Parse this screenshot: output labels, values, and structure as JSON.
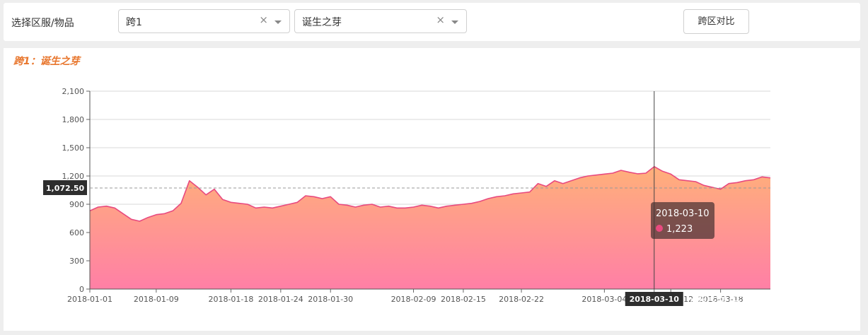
{
  "toolbar": {
    "label": "选择区服/物品",
    "server_select": {
      "value": "跨1",
      "clear": "×"
    },
    "item_select": {
      "value": "诞生之芽",
      "clear": "×"
    },
    "compare_button": "跨区对比"
  },
  "chart_data": {
    "type": "area",
    "title": "跨1：诞生之芽",
    "ylim": [
      0,
      2100
    ],
    "yticks": [
      0,
      300,
      600,
      900,
      1200,
      1500,
      1800,
      2100
    ],
    "ytick_labels": [
      "0",
      "300",
      "600",
      "900",
      "1,200",
      "1,500",
      "1,800",
      "2,100"
    ],
    "xtick_labels": [
      "2018-01-01",
      "2018-01-09",
      "2018-01-18",
      "2018-01-24",
      "2018-01-30",
      "2018-02-09",
      "2018-02-15",
      "2018-02-22",
      "2018-03-04",
      "2018-03-10",
      "2018-03-12",
      "2018-03-18"
    ],
    "x_start": "2018-01-01",
    "x_end": "2018-03-24",
    "grid": true,
    "average_line": {
      "value": 1072.5,
      "label": "1,072.50"
    },
    "crosshair": {
      "x": "2018-03-10",
      "label": "2018-03-10"
    },
    "tooltip": {
      "date": "2018-03-10",
      "value": 1223,
      "value_label": "1,223"
    },
    "colors": {
      "line": "#e84a7f",
      "fill_top": "#ffb07a",
      "fill_bottom": "#ff7fa6",
      "title": "#e8762d"
    },
    "x": [
      "2018-01-01",
      "2018-01-02",
      "2018-01-03",
      "2018-01-04",
      "2018-01-05",
      "2018-01-06",
      "2018-01-07",
      "2018-01-08",
      "2018-01-09",
      "2018-01-10",
      "2018-01-11",
      "2018-01-12",
      "2018-01-13",
      "2018-01-14",
      "2018-01-15",
      "2018-01-16",
      "2018-01-17",
      "2018-01-18",
      "2018-01-19",
      "2018-01-20",
      "2018-01-21",
      "2018-01-22",
      "2018-01-23",
      "2018-01-24",
      "2018-01-25",
      "2018-01-26",
      "2018-01-27",
      "2018-01-28",
      "2018-01-29",
      "2018-01-30",
      "2018-01-31",
      "2018-02-01",
      "2018-02-02",
      "2018-02-03",
      "2018-02-04",
      "2018-02-05",
      "2018-02-06",
      "2018-02-07",
      "2018-02-08",
      "2018-02-09",
      "2018-02-10",
      "2018-02-11",
      "2018-02-12",
      "2018-02-13",
      "2018-02-14",
      "2018-02-15",
      "2018-02-16",
      "2018-02-17",
      "2018-02-18",
      "2018-02-19",
      "2018-02-20",
      "2018-02-21",
      "2018-02-22",
      "2018-02-23",
      "2018-02-24",
      "2018-02-25",
      "2018-02-26",
      "2018-02-27",
      "2018-02-28",
      "2018-03-01",
      "2018-03-02",
      "2018-03-03",
      "2018-03-04",
      "2018-03-05",
      "2018-03-06",
      "2018-03-07",
      "2018-03-08",
      "2018-03-09",
      "2018-03-10",
      "2018-03-11",
      "2018-03-12",
      "2018-03-13",
      "2018-03-14",
      "2018-03-15",
      "2018-03-16",
      "2018-03-17",
      "2018-03-18",
      "2018-03-19",
      "2018-03-20",
      "2018-03-21",
      "2018-03-22",
      "2018-03-23",
      "2018-03-24"
    ],
    "values": [
      830,
      870,
      880,
      860,
      800,
      740,
      720,
      760,
      790,
      800,
      830,
      910,
      1150,
      1080,
      1000,
      1060,
      950,
      920,
      910,
      900,
      860,
      870,
      860,
      880,
      900,
      920,
      990,
      980,
      960,
      980,
      900,
      890,
      870,
      890,
      900,
      870,
      880,
      860,
      860,
      870,
      890,
      880,
      860,
      880,
      890,
      900,
      910,
      930,
      960,
      980,
      990,
      1010,
      1020,
      1030,
      1120,
      1090,
      1150,
      1120,
      1150,
      1180,
      1200,
      1210,
      1220,
      1230,
      1260,
      1240,
      1223,
      1230,
      1300,
      1250,
      1220,
      1160,
      1150,
      1140,
      1100,
      1080,
      1060,
      1120,
      1130,
      1150,
      1160,
      1190,
      1180
    ]
  },
  "watermark": "悟空问答"
}
